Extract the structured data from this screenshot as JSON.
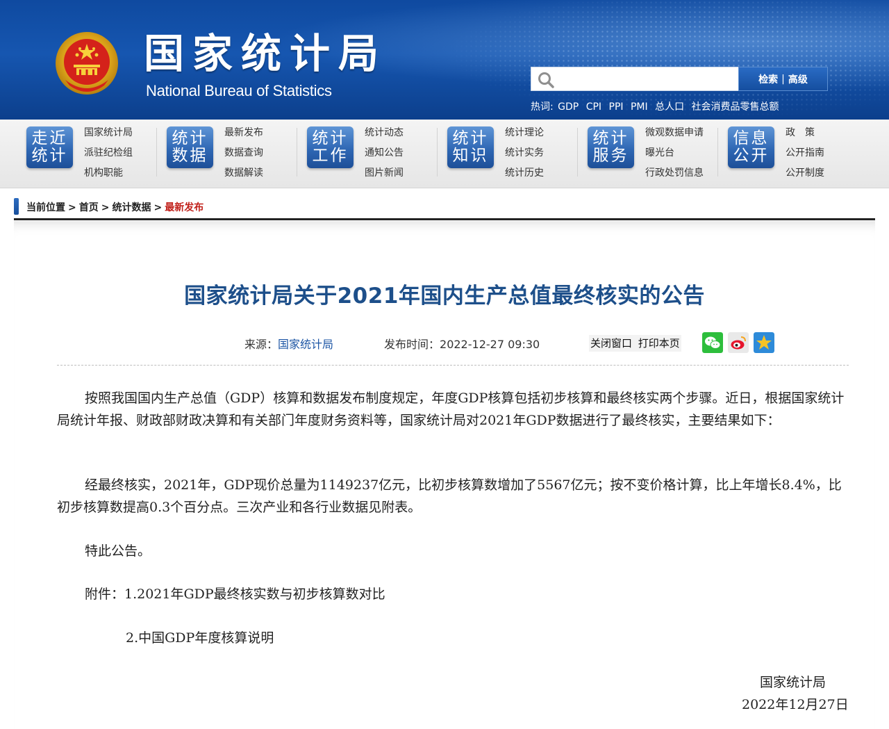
{
  "header": {
    "site_title": "国家统计局",
    "site_subtitle": "National Bureau of Statistics",
    "search": {
      "placeholder": "",
      "button_search": "检索",
      "button_sep": "|",
      "button_advanced": "高级"
    },
    "hot_words_label": "热词:",
    "hot_words": [
      "GDP",
      "CPI",
      "PPI",
      "PMI",
      "总人口",
      "社会消费品零售总额"
    ]
  },
  "nav": [
    {
      "badge": [
        "走近",
        "统计"
      ],
      "links": [
        "国家统计局",
        "派驻纪检组",
        "机构职能"
      ]
    },
    {
      "badge": [
        "统计",
        "数据"
      ],
      "links": [
        "最新发布",
        "数据查询",
        "数据解读"
      ]
    },
    {
      "badge": [
        "统计",
        "工作"
      ],
      "links": [
        "统计动态",
        "通知公告",
        "图片新闻"
      ]
    },
    {
      "badge": [
        "统计",
        "知识"
      ],
      "links": [
        "统计理论",
        "统计实务",
        "统计历史"
      ]
    },
    {
      "badge": [
        "统计",
        "服务"
      ],
      "links": [
        "微观数据申请",
        "曝光台",
        "行政处罚信息"
      ]
    },
    {
      "badge": [
        "信息",
        "公开"
      ],
      "links": [
        "政　策",
        "公开指南",
        "公开制度"
      ]
    }
  ],
  "breadcrumb": {
    "label": "当前位置",
    "items": [
      "首页",
      "统计数据"
    ],
    "current": "最新发布",
    "sep": ">"
  },
  "article": {
    "title": "国家统计局关于2021年国内生产总值最终核实的公告",
    "source_label": "来源：",
    "source": "国家统计局",
    "time_label": "发布时间：",
    "time": "2022-12-27 09:30",
    "tools": {
      "close": "关闭窗口",
      "print": "打印本页"
    },
    "share_icons": [
      "wechat-icon",
      "weibo-icon",
      "qzone-icon"
    ],
    "paragraphs": [
      "按照我国国内生产总值（GDP）核算和数据发布制度规定，年度GDP核算包括初步核算和最终核实两个步骤。近日，根据国家统计局统计年报、财政部财政决算和有关部门年度财务资料等，国家统计局对2021年GDP数据进行了最终核实，主要结果如下：",
      "经最终核实，2021年，GDP现价总量为1149237亿元，比初步核算数增加了5567亿元；按不变价格计算，比上年增长8.4%，比初步核算数提高0.3个百分点。三次产业和各行业数据见附表。",
      "特此公告。",
      "附件：1.2021年GDP最终核实数与初步核算数对比",
      "2.中国GDP年度核算说明"
    ],
    "signature": {
      "org": "国家统计局",
      "date": "2022年12月27日"
    }
  },
  "colors": {
    "header_blue": "#1656b0",
    "title_blue": "#1d4f8a",
    "breadcrumb_current": "#c1201a"
  }
}
